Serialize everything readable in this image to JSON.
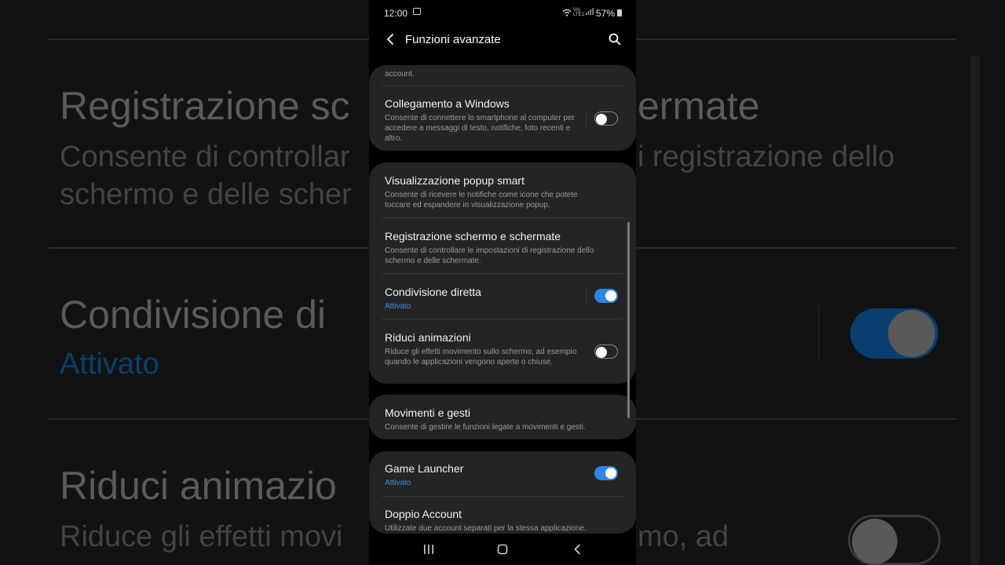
{
  "status_bar": {
    "time": "12:00",
    "network_label": "VoLTE LTE1",
    "battery": "57%"
  },
  "header": {
    "title": "Funzioni avanzate"
  },
  "cards": [
    {
      "items": [
        {
          "subtitle": "account."
        },
        {
          "title": "Collegamento a Windows",
          "subtitle": "Consente di connettere lo smartphone al computer per accedere a messaggi di testo, notifiche, foto recenti e altro.",
          "toggle": "off"
        }
      ]
    },
    {
      "items": [
        {
          "title": "Visualizzazione popup smart",
          "subtitle": "Consente di ricevere le notifiche come icone che potete toccare ed espandere in visualizzazione popup."
        },
        {
          "title": "Registrazione schermo e schermate",
          "subtitle": "Consente di controllare le impostazioni di registrazione dello schermo e delle schermate."
        },
        {
          "title": "Condivisione diretta",
          "subtitle": "Attivato",
          "toggle": "on"
        },
        {
          "title": "Riduci animazioni",
          "subtitle": "Riduce gli effetti movimento sullo schermo, ad esempio quando le applicazioni vengono aperte o chiuse.",
          "toggle": "off"
        }
      ]
    },
    {
      "items": [
        {
          "title": "Movimenti e gesti",
          "subtitle": "Consente di gestire le funzioni legate a movimenti e gesti."
        }
      ]
    },
    {
      "items": [
        {
          "title": "Game Launcher",
          "subtitle": "Attivato",
          "toggle": "on"
        },
        {
          "title": "Doppio Account",
          "subtitle": "Utilizzate due account separati per la stessa applicazione."
        }
      ]
    }
  ],
  "background": {
    "title1": "Registrazione sc",
    "title1_right": "ermate",
    "sub1_line1": "Consente di controllar",
    "sub1_line1_right": "i registrazione dello",
    "sub1_line2": "schermo e delle scher",
    "title2": "Condivisione di",
    "status2": "Attivato",
    "title3": "Riduci animazio",
    "sub3_line1": "Riduce gli effetti movi",
    "sub3_right": "mo, ad"
  },
  "colors": {
    "accent": "#2f86e6",
    "card": "#242424",
    "background": "#000000"
  }
}
